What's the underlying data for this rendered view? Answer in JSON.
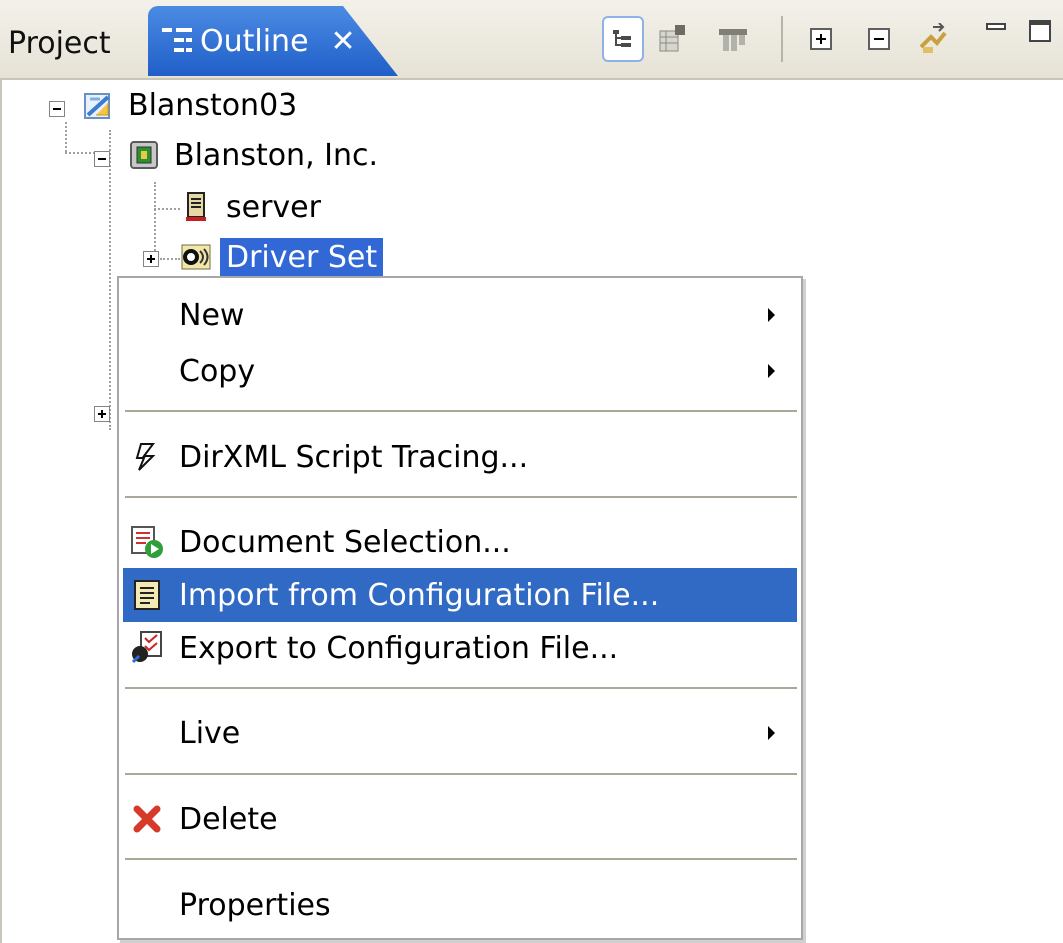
{
  "tabs": {
    "project": "Project",
    "outline": "Outline",
    "close": "✕"
  },
  "toolbar": {
    "icons": [
      "tree-view-icon",
      "properties-table-icon",
      "filter-icon",
      "expand-all-icon",
      "collapse-all-icon",
      "link-arrow-icon",
      "minimize-icon",
      "maximize-icon"
    ]
  },
  "tree": {
    "root": "Blanston03",
    "org": "Blanston, Inc.",
    "server": "server",
    "driver_set": "Driver Set"
  },
  "menu": {
    "new": "New",
    "copy": "Copy",
    "tracing": "DirXML Script Tracing...",
    "doc_selection": "Document Selection...",
    "import": "Import from Configuration File...",
    "export": "Export to Configuration File...",
    "live": "Live",
    "delete": "Delete",
    "properties": "Properties"
  },
  "colors": {
    "selection": "#316ac5",
    "tab_active": "#3168d5"
  }
}
